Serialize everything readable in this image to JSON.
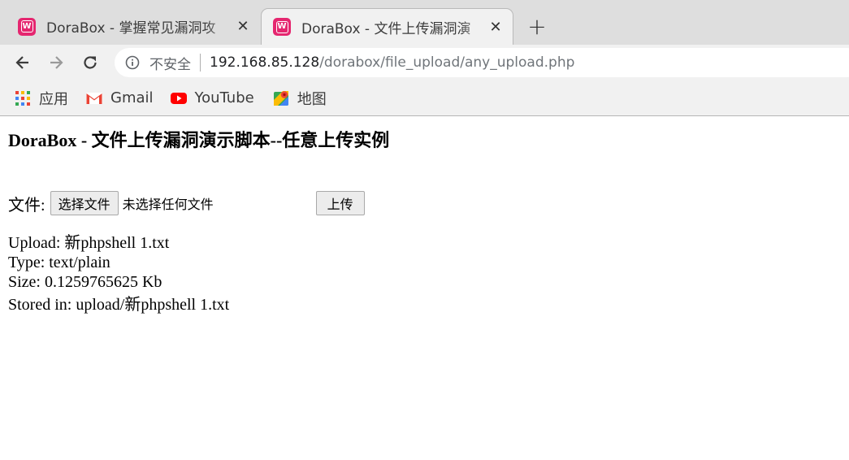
{
  "browser": {
    "tabs": [
      {
        "title": "DoraBox - 掌握常见漏洞攻",
        "favicon": "dorabox-favicon",
        "active": false
      },
      {
        "title": "DoraBox - 文件上传漏洞演",
        "favicon": "dorabox-favicon",
        "active": true
      }
    ],
    "favicon_letter": "W",
    "close_glyph": "✕",
    "new_tab_glyph": "+",
    "omnibox": {
      "security_label": "不安全",
      "url_host": "192.168.85.128",
      "url_path": "/dorabox/file_upload/any_upload.php"
    },
    "bookmarks": [
      {
        "label": "应用",
        "icon": "apps-grid-icon"
      },
      {
        "label": "Gmail",
        "icon": "gmail-icon"
      },
      {
        "label": "YouTube",
        "icon": "youtube-icon"
      },
      {
        "label": "地图",
        "icon": "maps-icon"
      }
    ]
  },
  "page": {
    "title": "DoraBox - 文件上传漏洞演示脚本--任意上传实例",
    "form": {
      "file_label": "文件:",
      "choose_button": "选择文件",
      "file_status": "未选择任何文件",
      "submit_button": "上传"
    },
    "result": {
      "upload": "Upload: 新phpshell 1.txt",
      "type": "Type: text/plain",
      "size": "Size: 0.1259765625 Kb",
      "stored": "Stored in: upload/新phpshell 1.txt"
    }
  },
  "colors": {
    "favicon": "#e5266f",
    "tabstrip": "#dedede",
    "toolbar": "#f1f1f1"
  }
}
